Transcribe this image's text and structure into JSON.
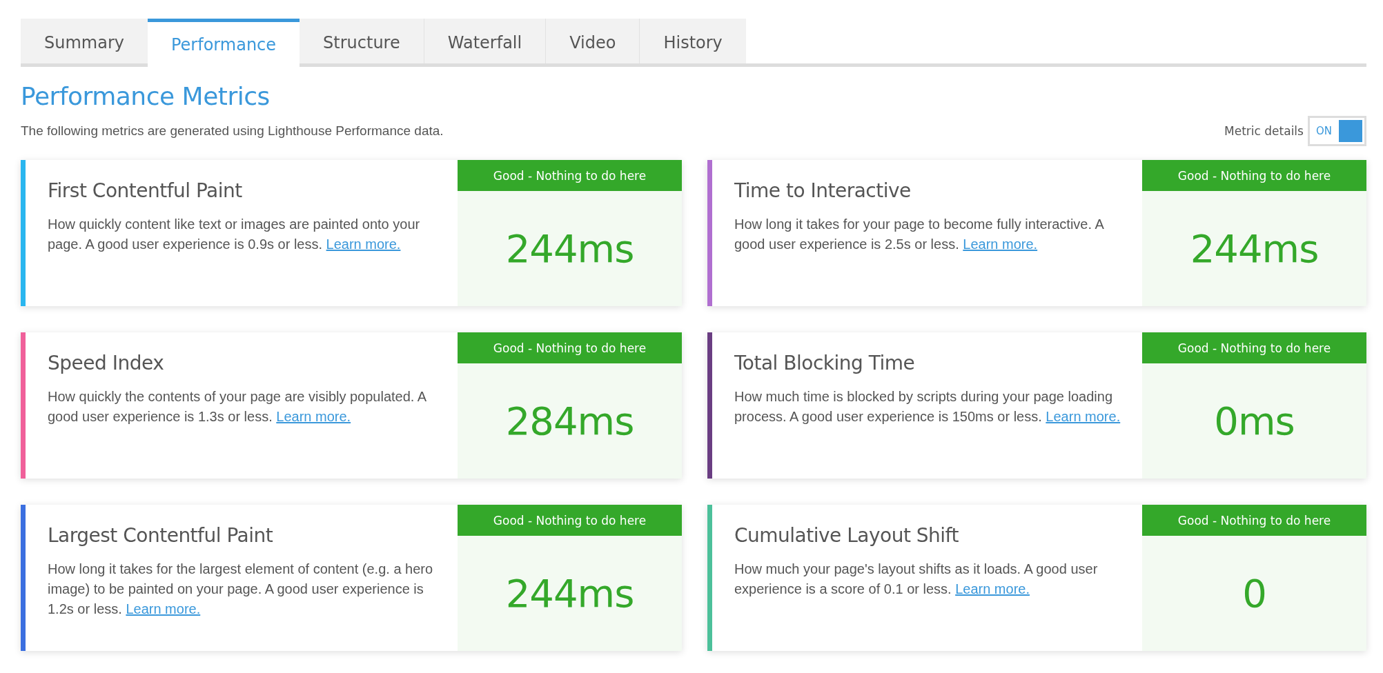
{
  "tabs": [
    {
      "label": "Summary",
      "selected": false
    },
    {
      "label": "Performance",
      "selected": true
    },
    {
      "label": "Structure",
      "selected": false
    },
    {
      "label": "Waterfall",
      "selected": false
    },
    {
      "label": "Video",
      "selected": false
    },
    {
      "label": "History",
      "selected": false
    }
  ],
  "heading": "Performance Metrics",
  "subtitle": "The following metrics are generated using Lighthouse Performance data.",
  "metric_details": {
    "label": "Metric details",
    "state_text": "ON",
    "on": true
  },
  "metrics": [
    {
      "name": "First Contentful Paint",
      "description": "How quickly content like text or images are painted onto your page. A good user experience is 0.9s or less.",
      "link": "Learn more.",
      "status": "Good - Nothing to do here",
      "value": "244ms",
      "color": "#2ab6ef"
    },
    {
      "name": "Time to Interactive",
      "description": "How long it takes for your page to become fully interactive. A good user experience is 2.5s or less.",
      "link": "Learn more.",
      "status": "Good - Nothing to do here",
      "value": "244ms",
      "color": "#b06fd0"
    },
    {
      "name": "Speed Index",
      "description": "How quickly the contents of your page are visibly populated. A good user experience is 1.3s or less.",
      "link": "Learn more.",
      "status": "Good - Nothing to do here",
      "value": "284ms",
      "color": "#f0609a"
    },
    {
      "name": "Total Blocking Time",
      "description": "How much time is blocked by scripts during your page loading process. A good user experience is 150ms or less.",
      "link": "Learn more.",
      "status": "Good - Nothing to do here",
      "value": "0ms",
      "color": "#6a3d82"
    },
    {
      "name": "Largest Contentful Paint",
      "description": "How long it takes for the largest element of content (e.g. a hero image) to be painted on your page. A good user experience is 1.2s or less.",
      "link": "Learn more.",
      "status": "Good - Nothing to do here",
      "value": "244ms",
      "color": "#3b6fe0"
    },
    {
      "name": "Cumulative Layout Shift",
      "description": "How much your page's layout shifts as it loads. A good user experience is a score of 0.1 or less.",
      "link": "Learn more.",
      "status": "Good - Nothing to do here",
      "value": "0",
      "color": "#4cc09a"
    }
  ]
}
